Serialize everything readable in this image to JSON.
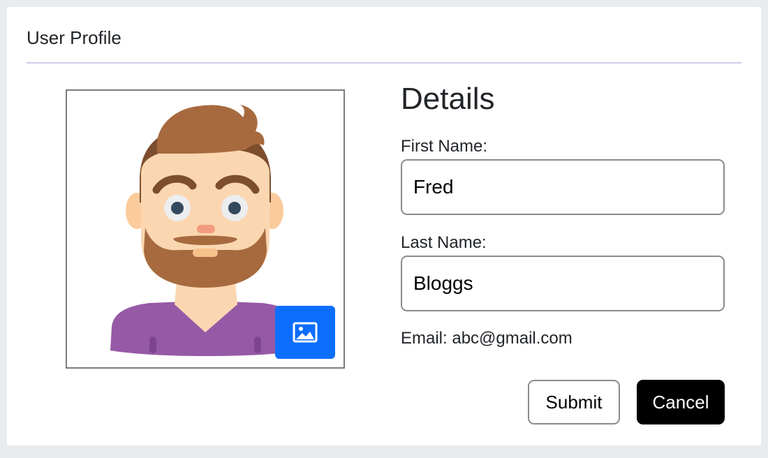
{
  "card": {
    "title": "User Profile"
  },
  "avatar": {
    "icon": "bearded-man-avatar",
    "change_image_icon": "image-icon",
    "accent_color": "#0d6efd"
  },
  "details": {
    "title": "Details",
    "first_name": {
      "label": "First Name:",
      "value": "Fred"
    },
    "last_name": {
      "label": "Last Name:",
      "value": "Bloggs"
    },
    "email": {
      "text": "Email: abc@gmail.com"
    }
  },
  "actions": {
    "submit_label": "Submit",
    "cancel_label": "Cancel"
  }
}
